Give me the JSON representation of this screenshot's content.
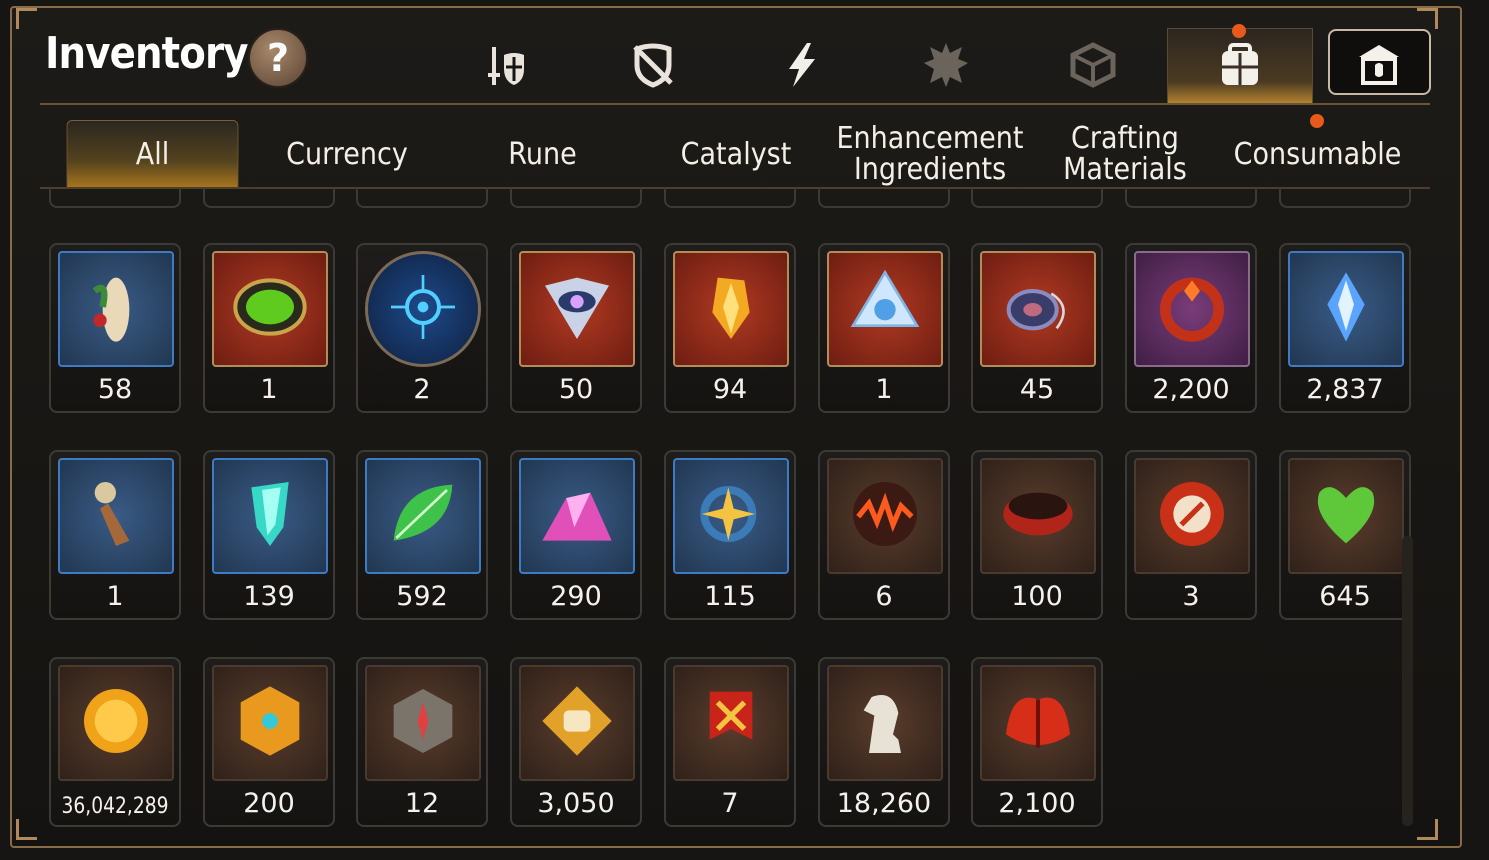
{
  "header": {
    "title": "Inventory",
    "help_label": "?"
  },
  "top_icons": [
    {
      "name": "sword-shield-icon"
    },
    {
      "name": "broken-shield-icon"
    },
    {
      "name": "lightning-icon"
    },
    {
      "name": "demon-icon"
    },
    {
      "name": "cube-icon"
    },
    {
      "name": "backpack-icon",
      "active": true
    },
    {
      "name": "shop-icon"
    }
  ],
  "tabs": [
    {
      "label": "All",
      "active": true
    },
    {
      "label": "Currency"
    },
    {
      "label": "Rune"
    },
    {
      "label": "Catalyst"
    },
    {
      "label": "Enhancement Ingredients"
    },
    {
      "label": "Crafting Materials"
    },
    {
      "label": "Consumable"
    }
  ],
  "items_row1": [
    {
      "icon": "ginseng-icon",
      "count": "58",
      "frame": "blue"
    },
    {
      "icon": "green-orb-icon",
      "count": "1",
      "frame": "red"
    },
    {
      "icon": "rune-circle-icon",
      "count": "2",
      "frame": "round"
    },
    {
      "icon": "eye-crest-icon",
      "count": "50",
      "frame": "red"
    },
    {
      "icon": "gold-crystal-icon",
      "count": "94",
      "frame": "red"
    },
    {
      "icon": "triangle-gem-icon",
      "count": "1",
      "frame": "red"
    },
    {
      "icon": "chakram-icon",
      "count": "45",
      "frame": "red"
    },
    {
      "icon": "fire-ring-icon",
      "count": "2,200",
      "frame": "purple"
    },
    {
      "icon": "blue-crystal-icon",
      "count": "2,837",
      "frame": "blue"
    }
  ],
  "items_row2": [
    {
      "icon": "pendant-icon",
      "count": "1",
      "frame": "blue"
    },
    {
      "icon": "teal-crystal-icon",
      "count": "139",
      "frame": "blue"
    },
    {
      "icon": "green-leaf-icon",
      "count": "592",
      "frame": "blue"
    },
    {
      "icon": "pink-ore-icon",
      "count": "290",
      "frame": "blue"
    },
    {
      "icon": "star-amulet-icon",
      "count": "115",
      "frame": "blue"
    },
    {
      "icon": "fire-orb-icon",
      "count": "6",
      "frame": "brown"
    },
    {
      "icon": "red-band-icon",
      "count": "100",
      "frame": "brown"
    },
    {
      "icon": "red-medal-icon",
      "count": "3",
      "frame": "brown"
    },
    {
      "icon": "green-heart-icon",
      "count": "645",
      "frame": "brown"
    }
  ],
  "items_row3": [
    {
      "icon": "gold-coin-icon",
      "count": "36,042,289",
      "frame": "brown",
      "small": true
    },
    {
      "icon": "gold-emblem-icon",
      "count": "200",
      "frame": "brown"
    },
    {
      "icon": "compass-cube-icon",
      "count": "12",
      "frame": "brown"
    },
    {
      "icon": "fist-badge-icon",
      "count": "3,050",
      "frame": "brown"
    },
    {
      "icon": "war-banner-icon",
      "count": "7",
      "frame": "brown"
    },
    {
      "icon": "chess-knight-icon",
      "count": "18,260",
      "frame": "brown"
    },
    {
      "icon": "red-leaf-icon",
      "count": "2,100",
      "frame": "brown"
    }
  ],
  "colors": {
    "accent": "#e85a1c",
    "gold": "#a9761f",
    "frame": "#8a6b48"
  }
}
